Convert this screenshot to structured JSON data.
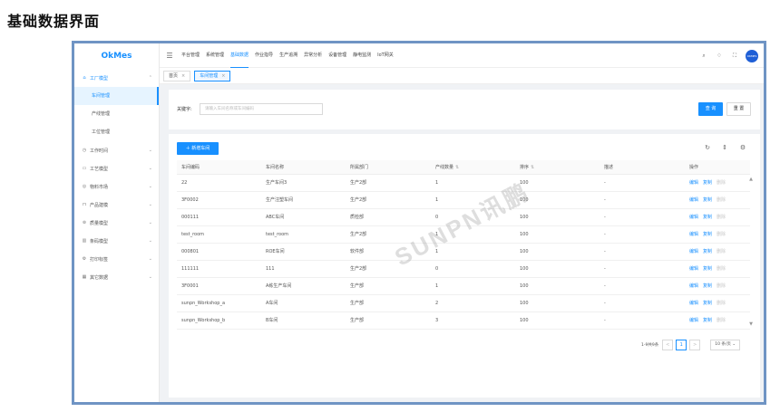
{
  "page_heading": "基础数据界面",
  "sidebar": {
    "logo": "OkMes",
    "items": [
      {
        "label": "工厂模型",
        "icon": "factory-icon",
        "expanded": true,
        "children": [
          "车间管理",
          "产线管理",
          "工位管理"
        ]
      },
      {
        "label": "工作时间",
        "icon": "clock-icon"
      },
      {
        "label": "工艺模型",
        "icon": "process-icon"
      },
      {
        "label": "物料市场",
        "icon": "material-icon"
      },
      {
        "label": "产品建模",
        "icon": "product-icon"
      },
      {
        "label": "质量模型",
        "icon": "quality-icon"
      },
      {
        "label": "条码模型",
        "icon": "barcode-icon"
      },
      {
        "label": "打印标签",
        "icon": "printer-icon"
      },
      {
        "label": "其它数据",
        "icon": "grid-icon"
      }
    ],
    "active_child": "车间管理"
  },
  "header": {
    "nav": [
      "平台管理",
      "系统管理",
      "基础数据",
      "作业指导",
      "生产追溯",
      "异常分析",
      "设备管理",
      "静电监测",
      "IoT网关"
    ],
    "active_nav": "基础数据",
    "avatar_text": "OKMES"
  },
  "tabs": [
    {
      "label": "首页",
      "active": false
    },
    {
      "label": "车间管理",
      "active": true
    }
  ],
  "search": {
    "label": "关键字:",
    "placeholder": "请输入车间名称或车间编码",
    "query_button": "查 询",
    "reset_button": "重 置"
  },
  "table": {
    "add_button": "新增车间",
    "columns": [
      "车间编码",
      "车间名称",
      "所属部门",
      "产线数量",
      "排序",
      "描述",
      "操作"
    ],
    "rows": [
      {
        "code": "22",
        "name": "生产车间3",
        "dept": "生产2部",
        "lines": "1",
        "sort": "100",
        "desc": "-"
      },
      {
        "code": "3F0002",
        "name": "生产注塑车间",
        "dept": "生产2部",
        "lines": "1",
        "sort": "100",
        "desc": "-"
      },
      {
        "code": "000111",
        "name": "ABC车间",
        "dept": "质检部",
        "lines": "0",
        "sort": "100",
        "desc": "-"
      },
      {
        "code": "test_room",
        "name": "test_room",
        "dept": "生产2部",
        "lines": "1",
        "sort": "100",
        "desc": "-"
      },
      {
        "code": "000801",
        "name": "ROE车间",
        "dept": "软件部",
        "lines": "1",
        "sort": "100",
        "desc": "-"
      },
      {
        "code": "111111",
        "name": "111",
        "dept": "生产2部",
        "lines": "0",
        "sort": "100",
        "desc": "-"
      },
      {
        "code": "3F0001",
        "name": "A栋生产车间",
        "dept": "生产部",
        "lines": "1",
        "sort": "100",
        "desc": "-"
      },
      {
        "code": "sunpn_Workshop_a",
        "name": "A车间",
        "dept": "生产部",
        "lines": "2",
        "sort": "100",
        "desc": "-"
      },
      {
        "code": "sunpn_Workshop_b",
        "name": "B车间",
        "dept": "生产部",
        "lines": "3",
        "sort": "100",
        "desc": "-"
      }
    ],
    "ops": {
      "edit": "编辑",
      "copy": "复制",
      "delete": "删除"
    }
  },
  "pagination": {
    "total_text": "1-9共9条",
    "prev": "<",
    "current": "1",
    "next": ">",
    "page_size": "10 条/页"
  },
  "watermark": "SUNPN讯鹏"
}
